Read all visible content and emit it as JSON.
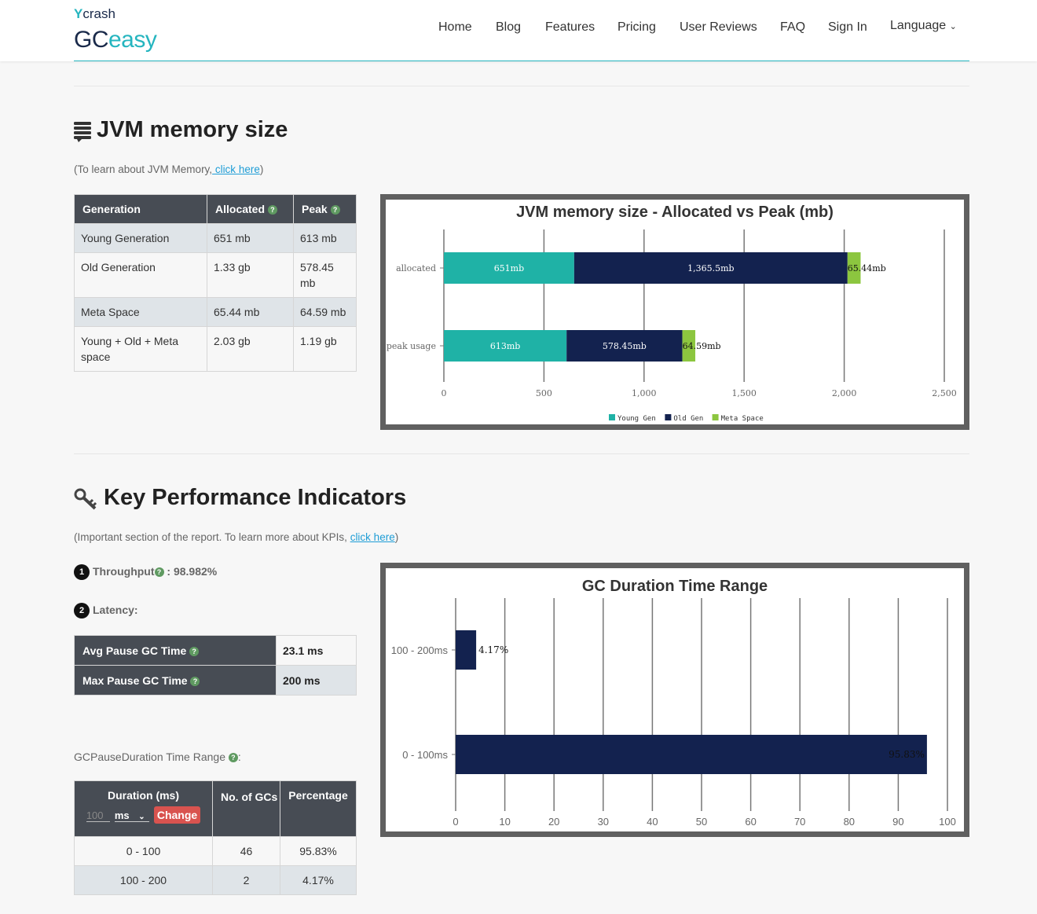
{
  "header": {
    "logo_top": "ycrash",
    "logo_top_y": "Y",
    "logo_top_rest": "crash",
    "logo_gc": "GC",
    "logo_easy": "easy",
    "nav": [
      "Home",
      "Blog",
      "Features",
      "Pricing",
      "User Reviews",
      "FAQ",
      "Sign In",
      "Language"
    ]
  },
  "memory": {
    "title": "JVM memory size",
    "note_prefix": "(To learn about JVM Memory,",
    "note_link": " click here",
    "note_suffix": ")",
    "columns": [
      "Generation",
      "Allocated",
      "Peak"
    ],
    "rows": [
      [
        "Young Generation",
        "651 mb",
        "613 mb"
      ],
      [
        "Old Generation",
        "1.33 gb",
        "578.45 mb"
      ],
      [
        "Meta Space",
        "65.44 mb",
        "64.59 mb"
      ],
      [
        "Young + Old + Meta space",
        "2.03 gb",
        "1.19 gb"
      ]
    ]
  },
  "kpi": {
    "title": "Key Performance Indicators",
    "note_prefix": "(Important section of the report. To learn more about KPIs, ",
    "note_link": "click here",
    "note_suffix": ")",
    "throughput_num": "1",
    "throughput_label": "Throughput",
    "throughput_value": " : 98.982%",
    "latency_num": "2",
    "latency_label": "Latency:",
    "pause_rows": [
      {
        "label": "Avg Pause GC Time",
        "value": "23.1 ms"
      },
      {
        "label": "Max Pause GC Time",
        "value": "200 ms"
      }
    ],
    "range_label": "GCPauseDuration Time Range",
    "range_suffix": ":",
    "duration_header": "Duration (ms)",
    "duration_input": "100",
    "duration_unit": "ms",
    "change_label": "Change",
    "gcs_header": "No. of GCs",
    "pct_header": "Percentage",
    "duration_rows": [
      [
        "0 - 100",
        "46",
        "95.83%"
      ],
      [
        "100 - 200",
        "2",
        "4.17%"
      ]
    ]
  },
  "chart_data": [
    {
      "type": "bar",
      "orientation": "horizontal",
      "stacked": true,
      "title": "JVM memory size - Allocated vs Peak (mb)",
      "categories": [
        "allocated",
        "peak usage"
      ],
      "series": [
        {
          "name": "Young Gen",
          "color": "#1fb2a6",
          "values": [
            651,
            613
          ],
          "labels": [
            "651mb",
            "613mb"
          ]
        },
        {
          "name": "Old Gen",
          "color": "#13224f",
          "values": [
            1365.5,
            578.45
          ],
          "labels": [
            "1,365.5mb",
            "578.45mb"
          ]
        },
        {
          "name": "Meta Space",
          "color": "#8cc63f",
          "values": [
            65.44,
            64.59
          ],
          "labels": [
            "65.44mb",
            "64.59mb"
          ]
        }
      ],
      "xlim": [
        0,
        2500
      ],
      "xticks": [
        0,
        500,
        1000,
        1500,
        2000,
        2500
      ],
      "xtick_labels": [
        "0",
        "500",
        "1,000",
        "1,500",
        "2,000",
        "2,500"
      ],
      "legend": "bottom",
      "grid": true
    },
    {
      "type": "bar",
      "orientation": "horizontal",
      "title": "GC Duration Time Range",
      "categories": [
        "100 - 200ms",
        "0 - 100ms"
      ],
      "values": [
        4.17,
        95.83
      ],
      "labels": [
        "4.17%",
        "95.83%"
      ],
      "color": "#13224f",
      "xlim": [
        0,
        100
      ],
      "xticks": [
        0,
        10,
        20,
        30,
        40,
        50,
        60,
        70,
        80,
        90,
        100
      ],
      "grid": true
    }
  ]
}
